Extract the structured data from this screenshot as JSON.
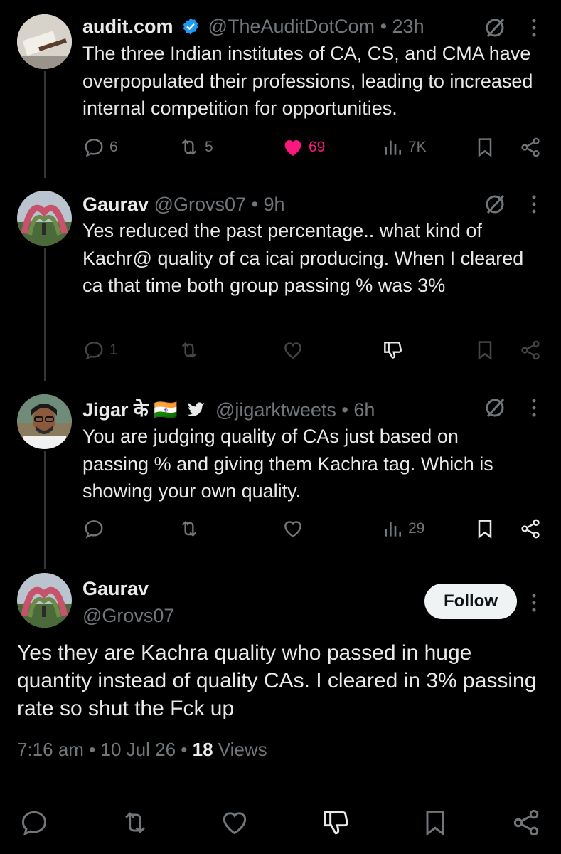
{
  "tweets": [
    {
      "name": "audit.com",
      "handle": "@TheAuditDotCom",
      "time": "23h",
      "text": "The three Indian institutes of CA, CS, and CMA have overpopulated their professions, leading to increased internal competition for opportunities.",
      "replies": "6",
      "retweets": "5",
      "likes": "69",
      "views": "7K",
      "liked": true,
      "verified": true
    },
    {
      "name": "Gaurav",
      "handle": "@Grovs07",
      "time": "9h",
      "text": "Yes reduced the past percentage.. what kind of Kachr@ quality of ca icai producing. When I cleared ca that time both group passing % was 3%",
      "replies": "1"
    },
    {
      "name": "Jigar के 🇮🇳",
      "handle": "@jigarktweets",
      "time": "6h",
      "text": "You are judging quality of CAs just based on passing % and giving them Kachra tag. Which is showing your own quality.",
      "views": "29"
    }
  ],
  "main_tweet": {
    "name": "Gaurav",
    "handle": "@Grovs07",
    "follow_label": "Follow",
    "text": "Yes they are Kachra quality who passed in huge quantity instead of quality CAs. I cleared in 3% passing rate so shut the Fck up",
    "time": "7:16 am",
    "date": "10 Jul 26",
    "views_count": "18",
    "views_label": "Views"
  },
  "separator": "•",
  "colors": {
    "background": "#000000",
    "text": "#e7e9ea",
    "muted": "#71767b",
    "like": "#f91880",
    "verified": "#1d9bf0"
  },
  "icons": [
    "reply-icon",
    "retweet-icon",
    "like-icon",
    "views-icon",
    "bookmark-icon",
    "share-icon",
    "grok-icon",
    "more-icon",
    "verified-badge-icon",
    "dislike-icon",
    "bird-icon"
  ]
}
